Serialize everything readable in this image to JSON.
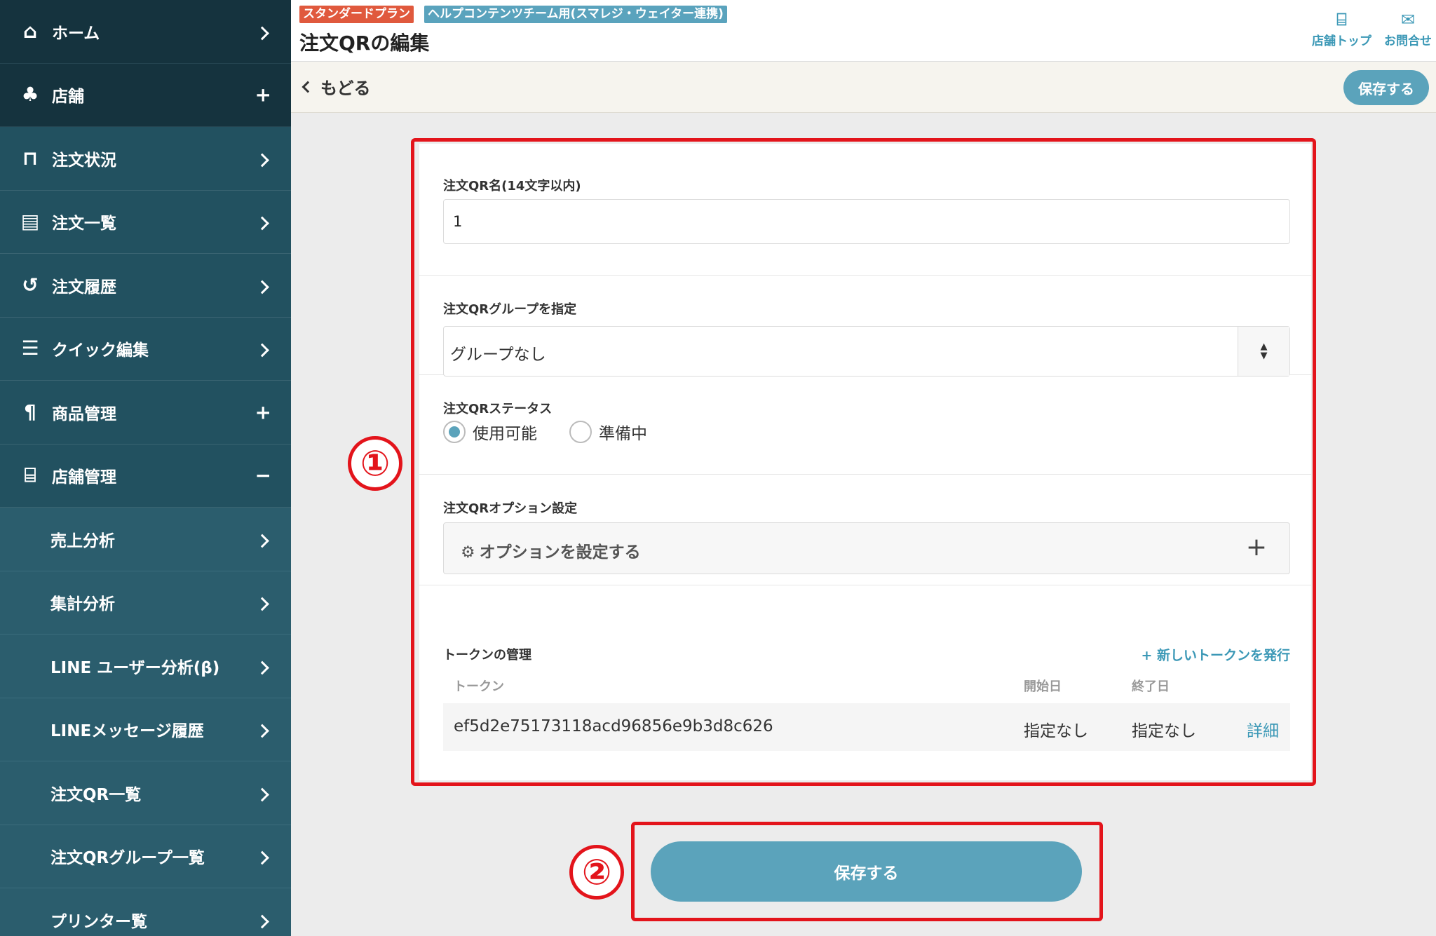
{
  "sidebar": {
    "items": [
      {
        "icon": "home-icon",
        "glyph": "⌂",
        "label": "ホーム",
        "trail": "chevron"
      },
      {
        "icon": "sitemap-icon",
        "glyph": "♣",
        "label": "店舗",
        "trail": "+"
      },
      {
        "icon": "chair-icon",
        "glyph": "⊓",
        "label": "注文状況",
        "trail": "chevron"
      },
      {
        "icon": "clipboard-icon",
        "glyph": "▤",
        "label": "注文一覧",
        "trail": "chevron"
      },
      {
        "icon": "history-icon",
        "glyph": "↺",
        "label": "注文履歴",
        "trail": "chevron"
      },
      {
        "icon": "list-check-icon",
        "glyph": "☰",
        "label": "クイック編集",
        "trail": "chevron"
      },
      {
        "icon": "utensils-icon",
        "glyph": "¶",
        "label": "商品管理",
        "trail": "+"
      },
      {
        "icon": "store-icon",
        "glyph": "⌸",
        "label": "店舗管理",
        "trail": "−"
      },
      {
        "label": "売上分析",
        "trail": "chevron"
      },
      {
        "label": "集計分析",
        "trail": "chevron"
      },
      {
        "label": "LINE ユーザー分析(β)",
        "trail": "chevron"
      },
      {
        "label": "LINEメッセージ履歴",
        "trail": "chevron"
      },
      {
        "label": "注文QR一覧",
        "trail": "chevron"
      },
      {
        "label": "注文QRグループ一覧",
        "trail": "chevron"
      },
      {
        "label": "プリンター覧",
        "trail": "chevron"
      }
    ]
  },
  "header": {
    "plan_badge": "スタンダードプラン",
    "team_badge": "ヘルプコンテンツチーム用(スマレジ・ウェイター連携)",
    "title": "注文QRの編集",
    "store_top": "店舗トップ",
    "contact": "お問合せ"
  },
  "toolbar": {
    "back": "もどる",
    "save": "保存する"
  },
  "form": {
    "name_label": "注文QR名(14文字以内)",
    "name_value": "1",
    "group_label": "注文QRグループを指定",
    "group_value": "グループなし",
    "status_label": "注文QRステータス",
    "status_options": [
      "使用可能",
      "準備中"
    ],
    "status_selected": "使用可能",
    "option_label": "注文QRオプション設定",
    "option_button": "オプションを設定する",
    "token_label": "トークンの管理",
    "new_token": "新しいトークンを発行",
    "token_columns": [
      "トークン",
      "開始日",
      "終了日"
    ],
    "tokens": [
      {
        "token": "ef5d2e75173118acd96856e9b3d8c626",
        "start": "指定なし",
        "end": "指定なし",
        "detail": "詳細"
      }
    ]
  },
  "bottom_save": "保存する",
  "annotations": [
    "①",
    "②"
  ],
  "colors": {
    "sidebar": "#225160",
    "accent": "#5ba3bb",
    "plan_badge": "#e0593d",
    "annotation_red": "#e3141b"
  }
}
